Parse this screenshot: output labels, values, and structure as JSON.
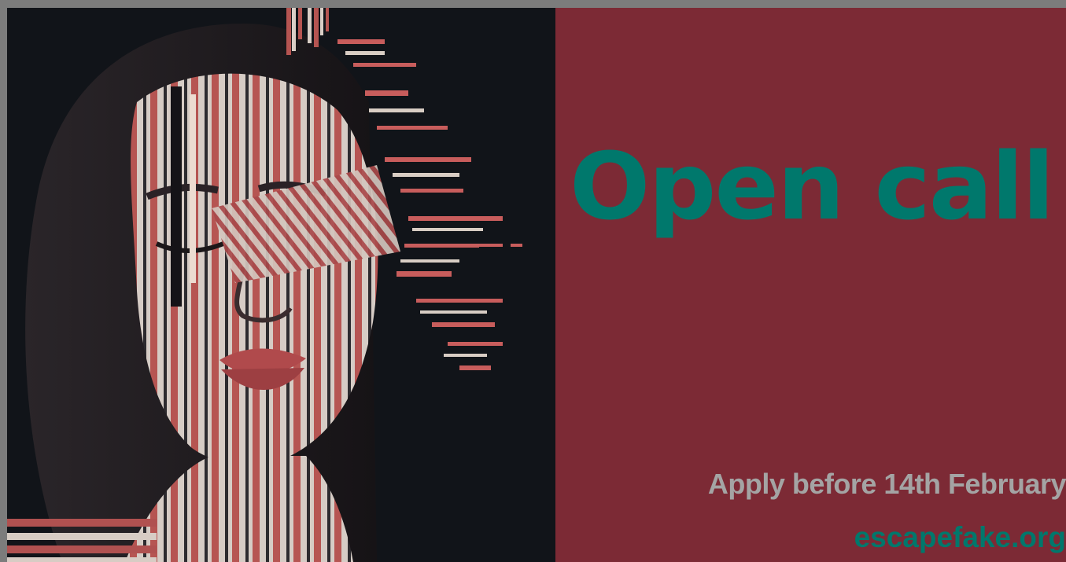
{
  "banner": {
    "headline": "Open call",
    "deadline": "Apply before 14th February",
    "website": "escapefake.org"
  },
  "artwork": {
    "subject": "portrait-with-striped-glitch-face"
  },
  "colors": {
    "frame": "#7c7c7c",
    "art_background": "#111419",
    "panel_background": "#7c2a35",
    "headline": "#00786c",
    "deadline_text": "#a4a4a4",
    "website_text": "#00786c",
    "skin_light": "#d9cfc8",
    "skin_red": "#b45350",
    "skin_dark": "#2b2a2e",
    "hair": "#1d1a1d"
  }
}
